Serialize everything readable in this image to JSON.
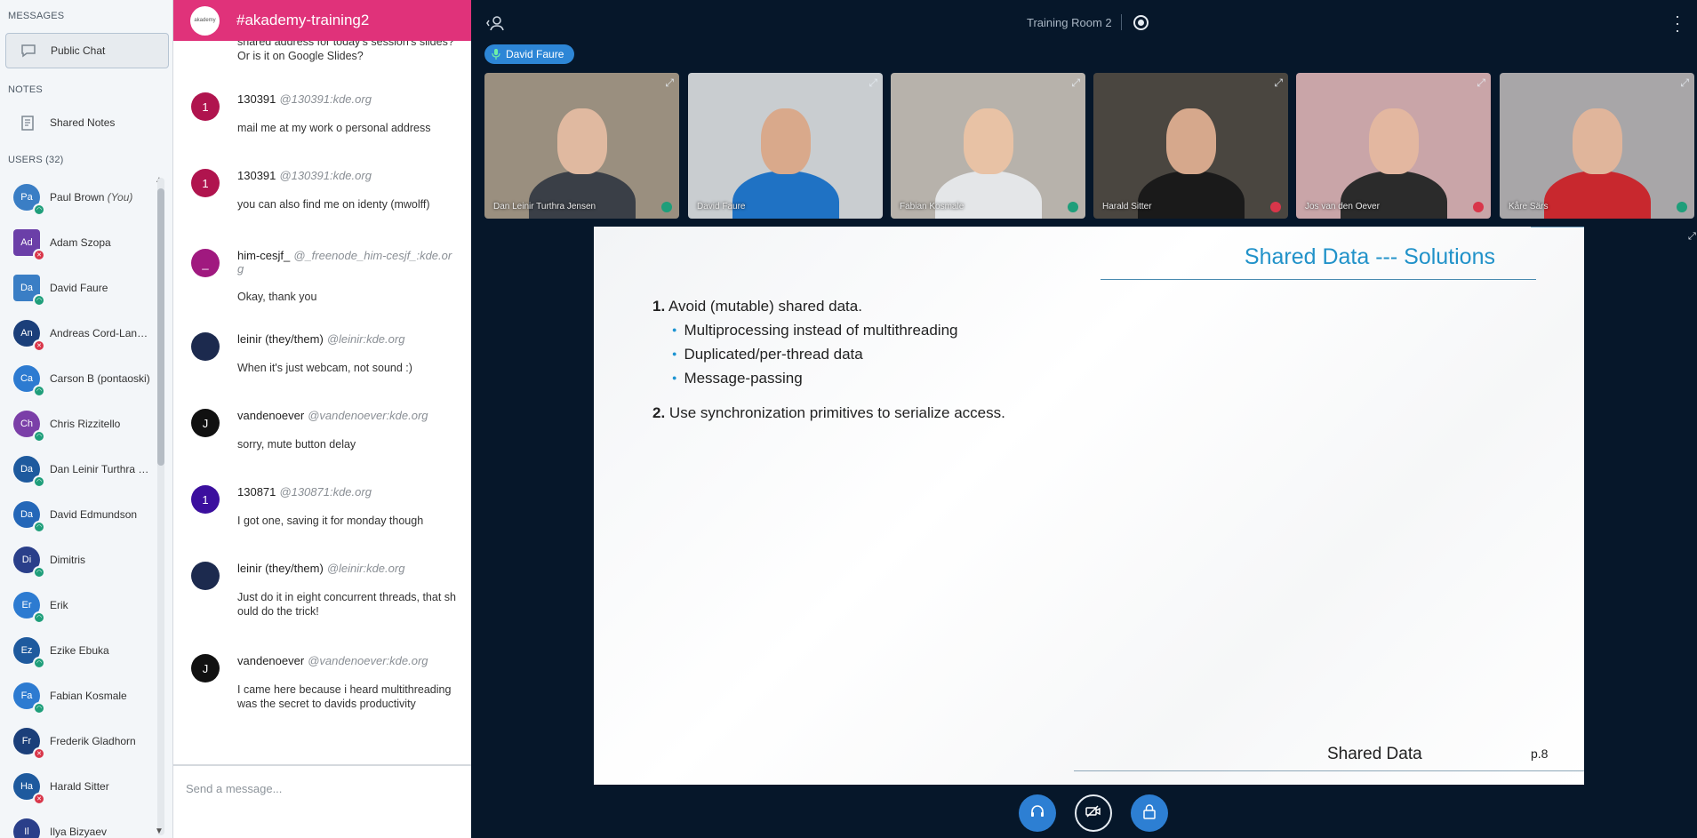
{
  "sidebar": {
    "messages_title": "MESSAGES",
    "public_chat": "Public Chat",
    "notes_title": "NOTES",
    "shared_notes": "Shared Notes",
    "users_title": "USERS (32)",
    "users": [
      {
        "initials": "Pa",
        "name": "Paul Brown",
        "you": "(You)",
        "color": "#3a7ec5",
        "status": "#1e9e7a",
        "status_icon": "headset",
        "square": false
      },
      {
        "initials": "Ad",
        "name": "Adam Szopa",
        "color": "#6b3fa8",
        "status": "#d9364a",
        "status_icon": "mic-off",
        "square": true
      },
      {
        "initials": "Da",
        "name": "David Faure",
        "color": "#3a7ec5",
        "status": "#1e9e7a",
        "status_icon": "headset",
        "square": true
      },
      {
        "initials": "An",
        "name": "Andreas Cord-Landwehr",
        "color": "#1b3f7a",
        "status": "#d9364a",
        "status_icon": "mic-off",
        "square": false
      },
      {
        "initials": "Ca",
        "name": "Carson B (pontaoski)",
        "color": "#2d7bd1",
        "status": "#1e9e7a",
        "status_icon": "headset",
        "square": false
      },
      {
        "initials": "Ch",
        "name": "Chris Rizzitello",
        "color": "#7b3fa8",
        "status": "#1e9e7a",
        "status_icon": "headset",
        "square": false
      },
      {
        "initials": "Da",
        "name": "Dan Leinir Turthra Jensen",
        "color": "#1e5a9e",
        "status": "#1e9e7a",
        "status_icon": "headset",
        "square": false
      },
      {
        "initials": "Da",
        "name": "David Edmundson",
        "color": "#2467b8",
        "status": "#1e9e7a",
        "status_icon": "headset",
        "square": false
      },
      {
        "initials": "Di",
        "name": "Dimitris",
        "color": "#2a3f8a",
        "status": "#1e9e7a",
        "status_icon": "headset",
        "square": false
      },
      {
        "initials": "Er",
        "name": "Erik",
        "color": "#2d7bd1",
        "status": "#1e9e7a",
        "status_icon": "headset",
        "square": false
      },
      {
        "initials": "Ez",
        "name": "Ezike Ebuka",
        "color": "#1e5a9e",
        "status": "#1e9e7a",
        "status_icon": "headset",
        "square": false
      },
      {
        "initials": "Fa",
        "name": "Fabian Kosmale",
        "color": "#2d7bd1",
        "status": "#1e9e7a",
        "status_icon": "headset",
        "square": false
      },
      {
        "initials": "Fr",
        "name": "Frederik Gladhorn",
        "color": "#1b3f7a",
        "status": "#d9364a",
        "status_icon": "mic-off",
        "square": false
      },
      {
        "initials": "Ha",
        "name": "Harald Sitter",
        "color": "#1e5a9e",
        "status": "#d9364a",
        "status_icon": "mic-off",
        "square": false
      },
      {
        "initials": "Il",
        "name": "Ilya Bizyaev",
        "color": "#2a3f8a",
        "status": "#1e9e7a",
        "status_icon": "headset",
        "square": false
      }
    ]
  },
  "chat": {
    "room": "#akademy-training2",
    "logo_text": "akademy",
    "input_placeholder": "Send a message...",
    "messages": [
      {
        "avatar": "",
        "avatar_color": "",
        "name": "",
        "handle": "",
        "text": "shared address for today's session's slides? Or is it on Google Slides?",
        "continuation": true
      },
      {
        "avatar": "1",
        "avatar_color": "#b0144e",
        "name": "130391",
        "handle": "@130391:kde.org",
        "text": "mail me at my work o personal address"
      },
      {
        "avatar": "1",
        "avatar_color": "#b0144e",
        "name": "130391",
        "handle": "@130391:kde.org",
        "text": "you can also find me on identy (mwolff)"
      },
      {
        "avatar": "_",
        "avatar_color": "#a0197f",
        "name": "him-cesjf_",
        "handle": "@_freenode_him-cesjf_:kde.org",
        "text": "Okay, thank you"
      },
      {
        "avatar": "",
        "avatar_color": "#1c2a4e",
        "name": "leinir (they/them)",
        "handle": "@leinir:kde.org",
        "text": "When it's just webcam, not sound :)"
      },
      {
        "avatar": "J",
        "avatar_color": "#111111",
        "name": "vandenoever",
        "handle": "@vandenoever:kde.org",
        "text": "sorry, mute button delay"
      },
      {
        "avatar": "1",
        "avatar_color": "#3b0f9e",
        "name": "130871",
        "handle": "@130871:kde.org",
        "text": "I got one, saving it for monday though"
      },
      {
        "avatar": "",
        "avatar_color": "#1c2a4e",
        "name": "leinir (they/them)",
        "handle": "@leinir:kde.org",
        "text": "Just do it in eight concurrent threads, that should do the trick!"
      },
      {
        "avatar": "J",
        "avatar_color": "#111111",
        "name": "vandenoever",
        "handle": "@vandenoever:kde.org",
        "text": "I came here because i heard multithreading was the secret to davids productivity"
      }
    ]
  },
  "main": {
    "room_title": "Training Room 2",
    "talking": "David Faure",
    "cameras": [
      {
        "name": "Dan Leinir Turthra Jensen",
        "status": "#1e9e7a",
        "bg": "#9a8f7f",
        "skin": "#e0b9a0",
        "shirt": "#3a3f47"
      },
      {
        "name": "David Faure",
        "status": "",
        "bg": "#c9cdd0",
        "skin": "#d9a98b",
        "shirt": "#1f72c4"
      },
      {
        "name": "Fabian Kosmale",
        "status": "#1e9e7a",
        "bg": "#b7b2ab",
        "skin": "#e8c2a5",
        "shirt": "#e4e6e8"
      },
      {
        "name": "Harald Sitter",
        "status": "#d9364a",
        "bg": "#4a4640",
        "skin": "#d6a88c",
        "shirt": "#1a1a1a"
      },
      {
        "name": "Jos van den Oever",
        "status": "#d9364a",
        "bg": "#c9a5a8",
        "skin": "#e3b7a0",
        "shirt": "#2b2b2b"
      },
      {
        "name": "Kåre Särs",
        "status": "#1e9e7a",
        "bg": "#a8a6a8",
        "skin": "#e0b59b",
        "shirt": "#c8282e"
      }
    ],
    "slide": {
      "title": "Shared Data --- Solutions",
      "point1_num": "1.",
      "point1": "Avoid (mutable) shared data.",
      "bullets": [
        "Multiprocessing instead of multithreading",
        "Duplicated/per-thread data",
        "Message-passing"
      ],
      "point2_num": "2.",
      "point2": "Use synchronization primitives to serialize access.",
      "footer": "Shared Data",
      "page": "p.8"
    },
    "actions": [
      "headset-icon",
      "video-off-icon",
      "lock-icon"
    ]
  }
}
